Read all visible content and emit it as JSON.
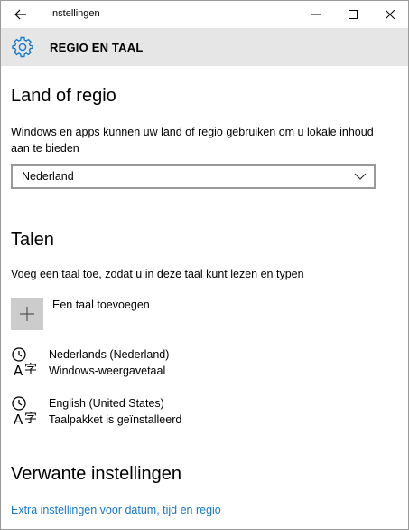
{
  "window": {
    "title": "Instellingen"
  },
  "header": {
    "title": "REGIO EN TAAL",
    "icon": "gear-icon"
  },
  "colors": {
    "header_bg": "#e6e6e6",
    "accent_link": "#1979ca",
    "tile_bg": "#cccccc"
  },
  "region": {
    "heading": "Land of regio",
    "description": "Windows en apps kunnen uw land of regio gebruiken om u lokale inhoud aan te bieden",
    "selected": "Nederland"
  },
  "languages": {
    "heading": "Talen",
    "description": "Voeg een taal toe, zodat u in deze taal kunt lezen en typen",
    "add_label": "Een taal toevoegen",
    "items": [
      {
        "name": "Nederlands (Nederland)",
        "status": "Windows-weergavetaal",
        "icon": "language-icon"
      },
      {
        "name": "English (United States)",
        "status": "Taalpakket is geïnstalleerd",
        "icon": "language-icon"
      }
    ]
  },
  "related": {
    "heading": "Verwante instellingen",
    "link": "Extra instellingen voor datum, tijd en regio"
  }
}
